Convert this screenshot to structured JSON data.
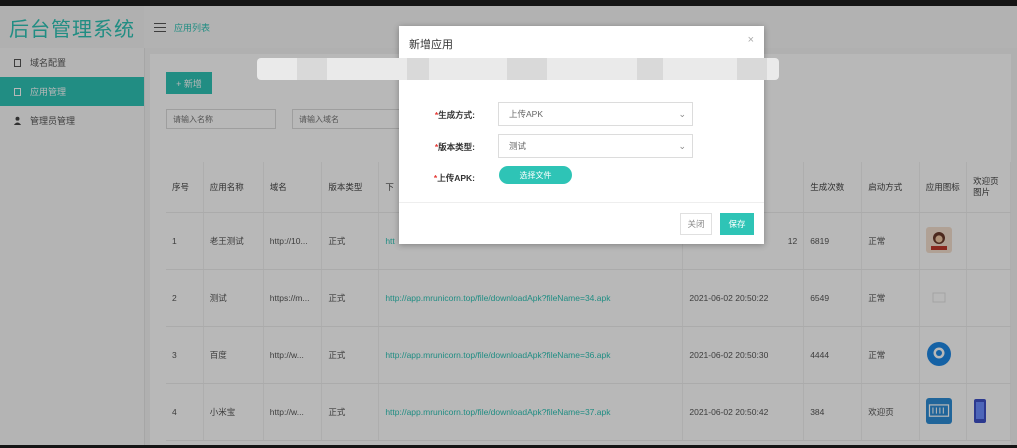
{
  "app": {
    "brand": "后台管理系统",
    "breadcrumb": "应用列表"
  },
  "sidebar": {
    "items": [
      {
        "label": "域名配置",
        "icon": "document-icon",
        "active": false
      },
      {
        "label": "应用管理",
        "icon": "document-icon",
        "active": true
      },
      {
        "label": "管理员管理",
        "icon": "user-icon",
        "active": false
      }
    ]
  },
  "toolbar": {
    "add_label": "+ 新增"
  },
  "filters": {
    "app_name_placeholder": "请输入名称",
    "domain_placeholder": "请输入域名"
  },
  "table": {
    "headers": [
      "序号",
      "应用名称",
      "域名",
      "版本类型",
      "下",
      "",
      "生成次数",
      "启动方式",
      "应用图标",
      "欢迎页图片"
    ],
    "rows": [
      {
        "no": "1",
        "name": "老王测试",
        "domain": "http://10...",
        "version": "正式",
        "link": "htt",
        "time": "12",
        "count": "6819",
        "launch": "正常",
        "icon": "portrait-icon",
        "welcome": ""
      },
      {
        "no": "2",
        "name": "测试",
        "domain": "https://m...",
        "version": "正式",
        "link": "http://app.mrunicorn.top/file/downloadApk?fileName=34.apk",
        "time": "2021-06-02 20:50:22",
        "count": "6549",
        "launch": "正常",
        "icon": "placeholder-icon",
        "welcome": ""
      },
      {
        "no": "3",
        "name": "百度",
        "domain": "http://w...",
        "version": "正式",
        "link": "http://app.mrunicorn.top/file/downloadApk?fileName=36.apk",
        "time": "2021-06-02 20:50:30",
        "count": "4444",
        "launch": "正常",
        "icon": "chat-bubble-icon",
        "welcome": ""
      },
      {
        "no": "4",
        "name": "小米宝",
        "domain": "http://w...",
        "version": "正式",
        "link": "http://app.mrunicorn.top/file/downloadApk?fileName=37.apk",
        "time": "2021-06-02 20:50:42",
        "count": "384",
        "launch": "欢迎页",
        "icon": "xiaomi-logo-icon",
        "welcome": "phone-icon"
      }
    ]
  },
  "modal": {
    "title": "新增应用",
    "close": "×",
    "fields": [
      {
        "label": "生成方式:",
        "value": "上传APK"
      },
      {
        "label": "版本类型:",
        "value": "测试"
      }
    ],
    "upload_label": "上传APK:",
    "upload_button": "选择文件",
    "cancel": "关闭",
    "save": "保存"
  },
  "colors": {
    "accent": "#2ec4b6",
    "required": "#e53935"
  }
}
